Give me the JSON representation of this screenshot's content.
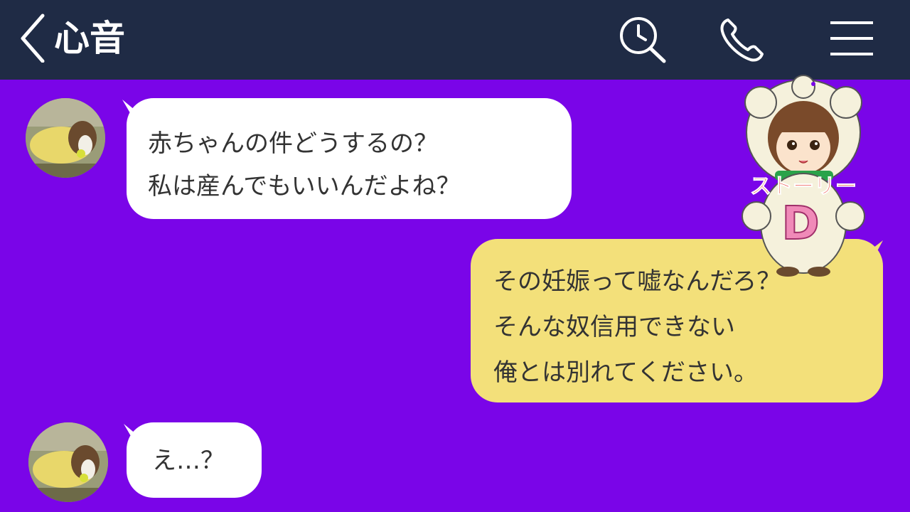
{
  "header": {
    "title": "心音",
    "icons": [
      "back-chevron-icon",
      "search-clock-icon",
      "phone-icon",
      "menu-icon"
    ]
  },
  "messages": [
    {
      "sender": "other",
      "lines": [
        "赤ちゃんの件どうするの？",
        "私は産んでもいいんだよね？"
      ]
    },
    {
      "sender": "self",
      "lines": [
        "その妊娠って嘘なんだろ？",
        "そんな奴信用できない",
        "俺とは別れてください。"
      ]
    },
    {
      "sender": "other",
      "lines": [
        "え…？"
      ]
    }
  ],
  "sticker": {
    "text": "ストーリー",
    "letter": "D"
  },
  "colors": {
    "header_bg": "#1f2b45",
    "chat_bg": "#7a05e8",
    "incoming_bubble": "#ffffff",
    "outgoing_bubble": "#f3e07a",
    "text": "#333333"
  }
}
